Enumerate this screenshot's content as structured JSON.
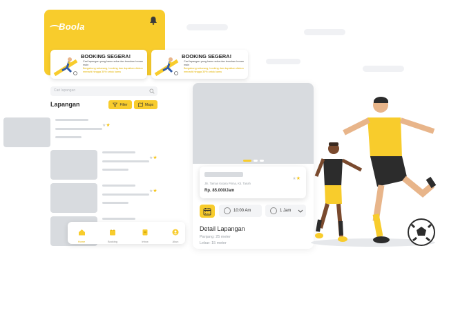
{
  "app": {
    "brand": "Boola"
  },
  "promos": [
    {
      "title": "BOOKING SEGERA!",
      "subtitle": "Cari lapangan yang kamu suka dan temukan teman main",
      "cta": "Bergabung sekarang, booking dan dapatkan diskon menarik hingga 30% untuk kamu"
    },
    {
      "title": "BOOKING SEGERA!",
      "subtitle": "Cari lapangan yang kamu suka dan temukan teman main",
      "cta": "Bergabung sekarang, booking dan dapatkan diskon menarik hingga 30% untuk kamu"
    }
  ],
  "search": {
    "placeholder": "Cari lapangan"
  },
  "list": {
    "title": "Lapangan",
    "filter_label": "Filter",
    "maps_label": "Maps"
  },
  "bottom_nav": [
    {
      "label": "Home",
      "icon": "home-icon"
    },
    {
      "label": "Booking",
      "icon": "calendar-icon"
    },
    {
      "label": "Inbox",
      "icon": "inbox-icon"
    },
    {
      "label": "Akun",
      "icon": "user-icon"
    }
  ],
  "detail": {
    "address": "Jln. Taman Kutara Prima, Kb. Tanah",
    "price": "Rp. 85.000/Jam",
    "time": "10:00 Am",
    "duration": "1 Jam",
    "section_title": "Detail Lapangan",
    "length": "Panjang: 25 meter",
    "width": "Lebar: 15 meter"
  },
  "colors": {
    "accent": "#f8cc2c",
    "placeholder": "#d8dbdf",
    "rating": "#f5c518"
  }
}
